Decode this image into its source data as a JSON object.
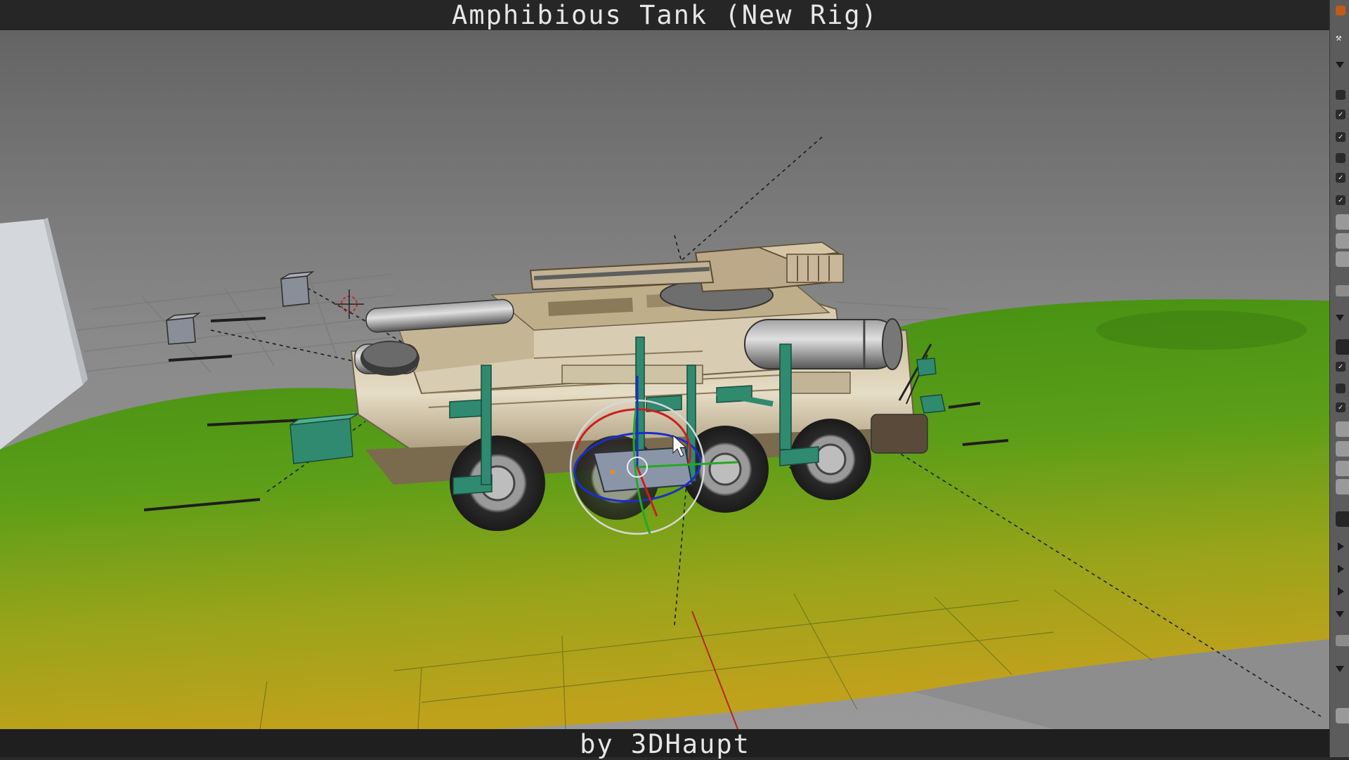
{
  "header": {
    "title": "Amphibious Tank (New Rig)"
  },
  "footer": {
    "credit": "by 3DHaupt"
  },
  "viewport": {
    "scene": "Blender 3D viewport showing a rigged eight-wheeled amphibious tank on green terrain",
    "manipulator": "rotate-gizmo"
  },
  "side_panel": {
    "icons": [
      "disclosure-triangle",
      "checkbox",
      "checkbox-checked",
      "slider-field",
      "collapsed-triangle"
    ]
  },
  "colors": {
    "background_top": "#767676",
    "terrain_green": "#4f9a19",
    "terrain_yellow": "#bda11c",
    "rig_bone": "#2f8a70",
    "axis_x": "#cc2222",
    "axis_y": "#22aa22",
    "axis_z": "#2244cc"
  }
}
